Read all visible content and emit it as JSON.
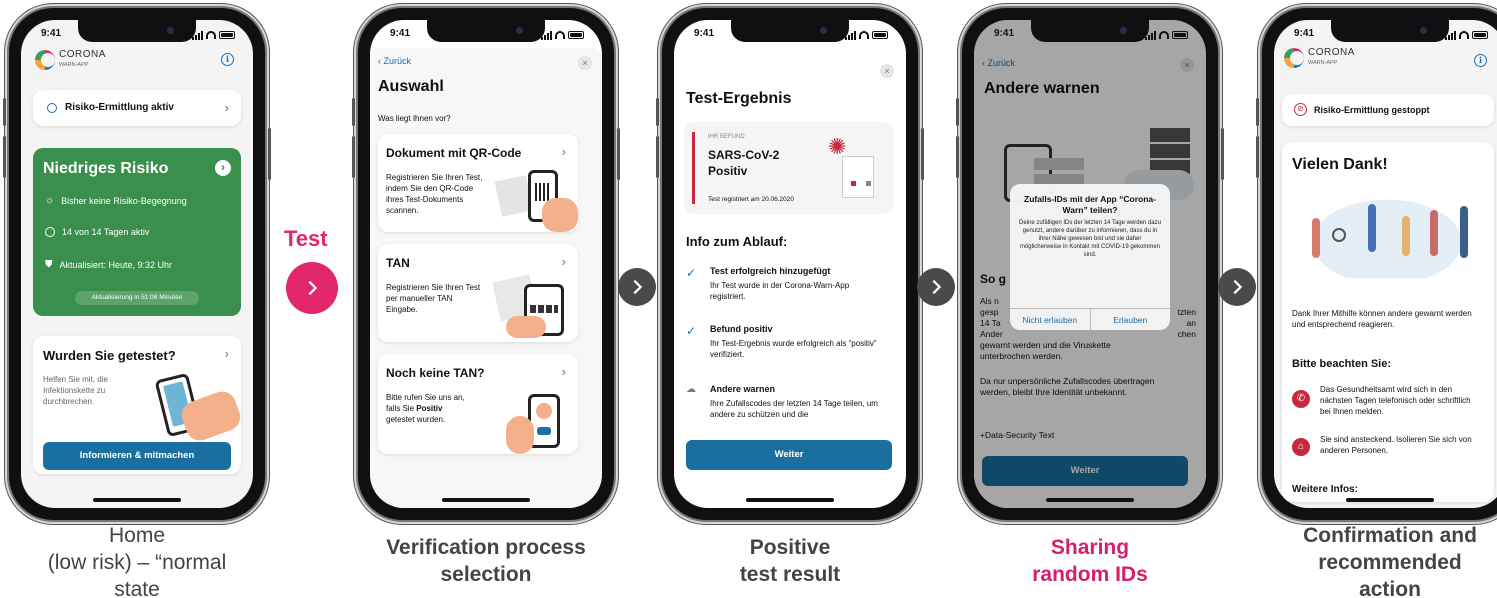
{
  "status_time": "9:41",
  "colors": {
    "brand_pink": "#e3276c",
    "green": "#3a8f4c",
    "blue": "#1a6fa0",
    "red_accent": "#c8283c"
  },
  "phone1": {
    "logo_title": "CORONA",
    "logo_sub": "WARN-APP",
    "risk_status": "Risiko-Ermittlung aktiv",
    "risk_card": {
      "title": "Niedriges Risiko",
      "line1": "Bisher keine Risiko-Begegnung",
      "line2": "14 von 14 Tagen aktiv",
      "line3": "Aktualisiert: Heute, 9:32 Uhr",
      "update_pill": "Aktualisierung in 51:08 Minuten"
    },
    "test_card": {
      "title": "Wurden Sie getestet?",
      "text": "Helfen Sie mit, die Infektionskette zu durchbrechen.",
      "button": "Informieren & mitmachen"
    },
    "caption_l1": "Home",
    "caption_l2": "(low risk) – “normal",
    "caption_l3": "state"
  },
  "test_label": "Test",
  "phone2": {
    "back": "Zurück",
    "title": "Auswahl",
    "subtitle": "Was liegt Ihnen vor?",
    "options": [
      {
        "title": "Dokument mit QR-Code",
        "text": "Registrieren Sie Ihren Test, indem Sie den QR-Code ihres Test-Dokuments scannen."
      },
      {
        "title": "TAN",
        "text": "Registrieren Sie Ihren Test per manueller TAN Eingabe."
      },
      {
        "title": "Noch keine TAN?",
        "text_a": "Bitte rufen Sie uns an, falls Sie ",
        "text_b": "Positiv",
        "text_c": " getestet wurden."
      }
    ],
    "caption_l1": "Verification process",
    "caption_l2": "selection"
  },
  "phone3": {
    "title": "Test-Ergebnis",
    "result_label": "IHR BEFUND",
    "result_l1": "SARS-CoV-2",
    "result_l2": "Positiv",
    "registered": "Test registriert am 20.06.2020",
    "section": "Info zum Ablauf:",
    "steps": [
      {
        "title": "Test erfolgreich hinzugefügt",
        "text": "Ihr Test wurde in der Corona-Warn-App registriert."
      },
      {
        "title": "Befund positiv",
        "text": "Ihr Test-Ergebnis wurde erfolgreich als “positiv” verifiziert."
      },
      {
        "title": "Andere warnen",
        "text": "Ihre Zufallscodes der letzten 14 Tage teilen, um andere zu schützen und die"
      }
    ],
    "button": "Weiter",
    "caption_l1": "Positive",
    "caption_l2": "test result"
  },
  "phone4": {
    "back": "Zurück",
    "title": "Andere warnen",
    "heading_partial": "So g",
    "body_frag1": "Als n",
    "body_frag2": "gesp",
    "body_frag3": "14 Ta",
    "body_frag4": "Ander",
    "body_right1": "tzten",
    "body_right2": "an",
    "body_right3": "chen",
    "body_l5": "gewarnt werden und die Viruskette",
    "body_l6": "unterbrochen werden.",
    "body2": "Da nur unpersönliche Zufallscodes übertragen werden, bleibt Ihre Identität unbekannt.",
    "link": "+Data-Security Text",
    "button": "Weiter",
    "dialog": {
      "title": "Zufalls-IDs mit der App “Corona-Warn” teilen?",
      "text": "Deine zufälligen IDs der letzten 14 Tage werden dazu genutzt, andere darüber zu informieren, dass du in ihrer Nähe gewesen bist und sie daher möglicherweise in Kontakt mit COVID-19 gekommen sind.",
      "deny": "Nicht erlauben",
      "allow": "Erlauben"
    },
    "caption_l1": "Sharing",
    "caption_l2": "random IDs"
  },
  "phone5": {
    "logo_title": "CORONA",
    "logo_sub": "WARN-APP",
    "status": "Risiko-Ermittlung gestoppt",
    "title": "Vielen Dank!",
    "text": "Dank Ihrer Mithilfe können andere gewarnt werden und entsprechend reagieren.",
    "section": "Bitte beachten Sie:",
    "items": [
      {
        "text": "Das Gesundheitsamt wird sich in den nächsten Tagen telefonisch oder schriftlich bei Ihnen melden."
      },
      {
        "text": "Sie sind ansteckend. Isolieren Sie sich von anderen Personen."
      }
    ],
    "more": "Weitere Infos:",
    "caption_l1": "Confirmation and",
    "caption_l2": "recommended",
    "caption_l3": "action"
  }
}
